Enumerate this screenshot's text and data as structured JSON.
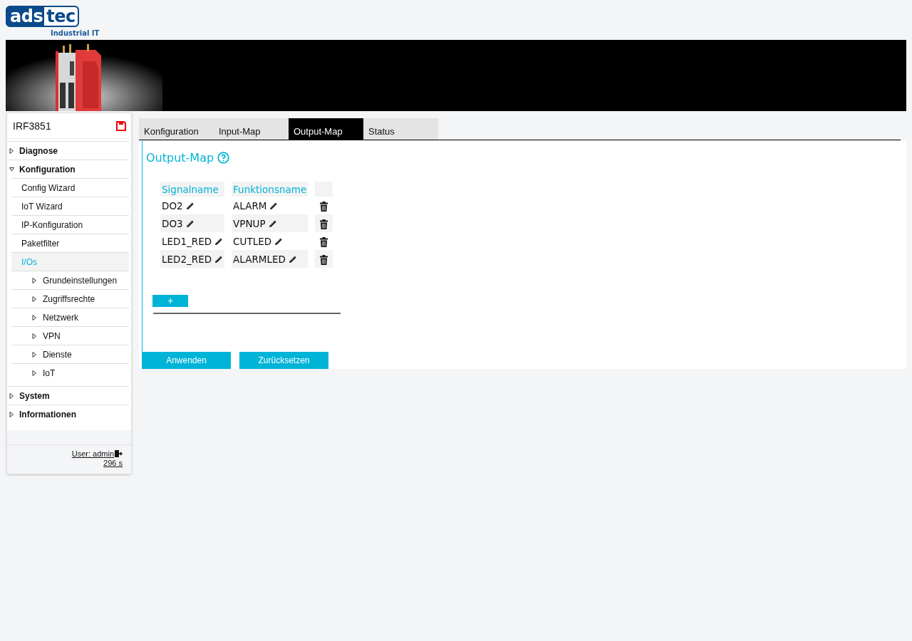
{
  "logo": {
    "part_1": "ads",
    "part_2": "tec",
    "tagline": "Industrial IT"
  },
  "sidebar": {
    "device": "IRF3851",
    "items": [
      {
        "label": "Diagnose",
        "expanded": false,
        "selected": false
      },
      {
        "label": "Konfiguration",
        "expanded": true,
        "selected": false,
        "children": [
          {
            "label": "Config Wizard",
            "selected": false
          },
          {
            "label": "IoT Wizard",
            "selected": false
          },
          {
            "label": "IP-Konfiguration",
            "selected": false
          },
          {
            "label": "Paketfilter",
            "selected": false
          },
          {
            "label": "I/Os",
            "selected": true
          },
          {
            "label": "Grundeinstellungen",
            "selected": false,
            "expanded": false
          },
          {
            "label": "Zugriffsrechte",
            "selected": false,
            "expanded": false
          },
          {
            "label": "Netzwerk",
            "selected": false,
            "expanded": false
          },
          {
            "label": "VPN",
            "selected": false,
            "expanded": false
          },
          {
            "label": "Dienste",
            "selected": false,
            "expanded": false
          },
          {
            "label": "IoT",
            "selected": false,
            "expanded": false
          }
        ]
      },
      {
        "label": "System",
        "expanded": false,
        "selected": false
      },
      {
        "label": "Informationen",
        "expanded": false,
        "selected": false
      }
    ],
    "user": "User: admin",
    "timer": "296 s"
  },
  "tabs": [
    {
      "label": "Konfiguration",
      "selected": false
    },
    {
      "label": "Input-Map",
      "selected": false
    },
    {
      "label": "Output-Map",
      "selected": true
    },
    {
      "label": "Status",
      "selected": false
    }
  ],
  "panel": {
    "title": "Output-Map",
    "table": {
      "columns": [
        "Signalname",
        "Funktionsname"
      ],
      "rows": [
        {
          "signal": "DO2",
          "function": "ALARM"
        },
        {
          "signal": "DO3",
          "function": "VPNUP"
        },
        {
          "signal": "LED1_RED",
          "function": "CUTLED"
        },
        {
          "signal": "LED2_RED",
          "function": "ALARMLED"
        }
      ]
    },
    "add_button": "+",
    "buttons": [
      "Anwenden",
      "Zurücksetzen"
    ]
  }
}
